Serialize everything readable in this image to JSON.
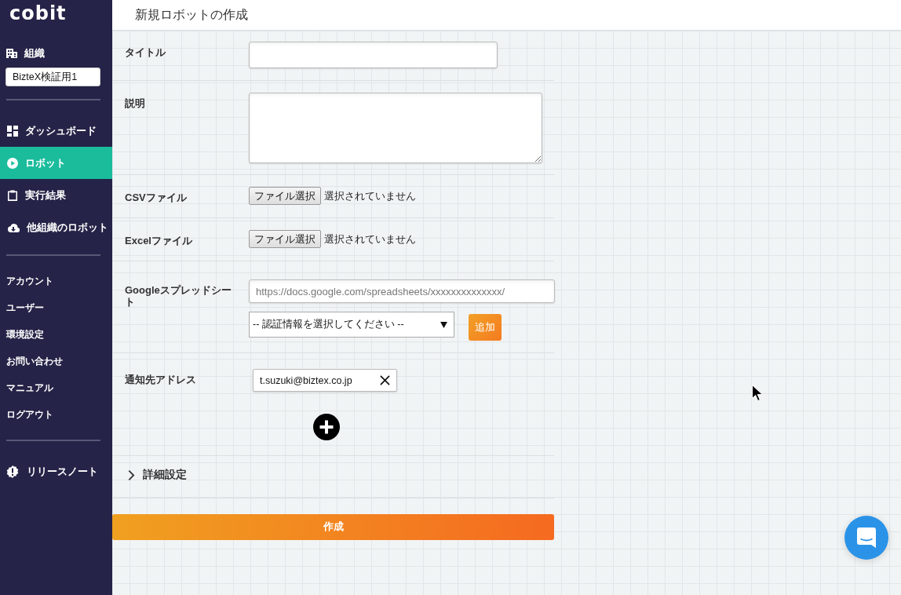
{
  "sidebar": {
    "logo": "cobit",
    "organization": {
      "label": "組織",
      "value": "BizteX検証用1"
    },
    "nav": [
      {
        "label": "ダッシュボード",
        "selected": false
      },
      {
        "label": "ロボット",
        "selected": true
      },
      {
        "label": "実行結果",
        "selected": false
      },
      {
        "label": "他組織のロボット",
        "selected": false
      }
    ],
    "links": [
      "アカウント",
      "ユーザー",
      "環境設定",
      "お問い合わせ",
      "マニュアル",
      "ログアウト"
    ],
    "release_notes": "リリースノート"
  },
  "header": {
    "title": "新規ロボットの作成"
  },
  "form": {
    "fields": [
      {
        "kind": "text",
        "label": "タイトル"
      },
      {
        "kind": "textarea",
        "label": "説明"
      },
      {
        "kind": "file",
        "label": "CSVファイル",
        "button": "ファイル選択",
        "status": "選択されていません"
      },
      {
        "kind": "file",
        "label": "Excelファイル",
        "button": "ファイル選択",
        "status": "選択されていません"
      },
      {
        "kind": "spreadsheet",
        "label": "Googleスプレッドシート",
        "placeholder": "https://docs.google.com/spreadsheets/xxxxxxxxxxxxxx/",
        "select": "-- 認証情報を選択してください --",
        "button": "追加"
      },
      {
        "kind": "emails",
        "label": "通知先アドレス",
        "emails": [
          "t.suzuki@biztex.co.jp"
        ]
      }
    ],
    "advanced": {
      "label": "詳細設定",
      "expanded": false
    },
    "submit": "作成"
  }
}
